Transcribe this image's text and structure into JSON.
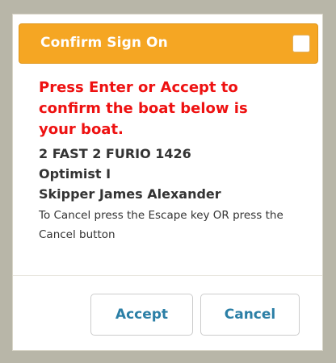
{
  "dialog": {
    "title": "Confirm Sign On",
    "warning": "Press Enter or Accept to confirm the boat below is your boat.",
    "boat": {
      "name_line": "2 FAST 2 FURIO 1426",
      "class_line": "Optimist I",
      "skipper_line": "Skipper James Alexander"
    },
    "cancel_note": "To Cancel press the Escape key OR press the Cancel button",
    "buttons": {
      "accept": "Accept",
      "cancel": "Cancel"
    }
  },
  "colors": {
    "title_bar": "#f5a623",
    "warning_text": "#ee1111",
    "button_text": "#2b7fa6",
    "backdrop": "#b8b6a8"
  },
  "icons": {
    "close": "close-checkbox-icon"
  }
}
